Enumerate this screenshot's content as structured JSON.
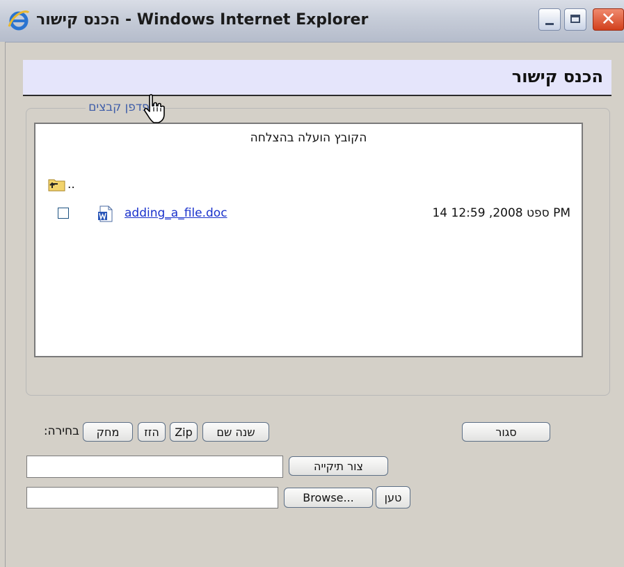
{
  "window": {
    "title": "הכנס קישור - Windows Internet Explorer",
    "controls": {
      "close_glyph": "✕"
    }
  },
  "header": {
    "title": "הכנס קישור"
  },
  "file_browser": {
    "legend": "דפדפן קבצים",
    "status_message": "הקובץ הועלה בהצלחה",
    "parent_folder_label": "..",
    "files": [
      {
        "name": "adding_a_file.doc",
        "modified": "14 ספט 2008, 12:59 PM",
        "checked": false
      }
    ]
  },
  "actions": {
    "close_label": "סגור",
    "rename_label": "שנה שם",
    "zip_label": "Zip",
    "move_label": "הזז",
    "delete_label": "מחק",
    "selection_label": "בחירה:"
  },
  "create_folder": {
    "value": "",
    "button_label": "צור תיקייה"
  },
  "upload": {
    "value": "",
    "browse_label": "Browse...",
    "upload_label": "טען"
  }
}
